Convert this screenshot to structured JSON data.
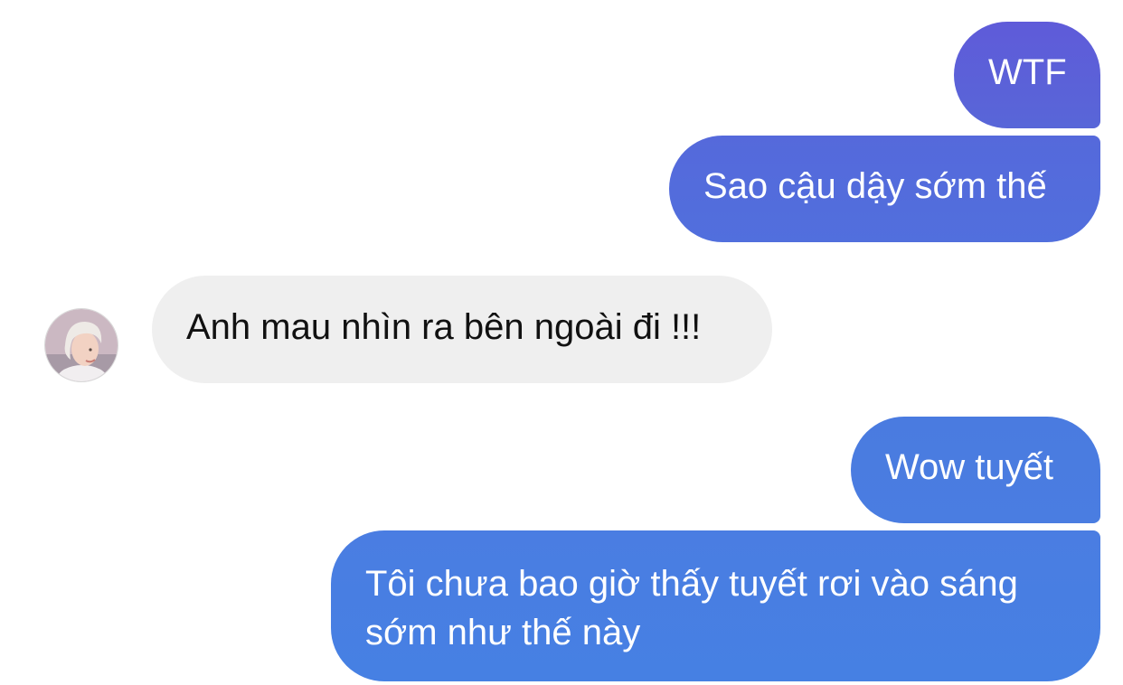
{
  "messages": [
    {
      "sender": "me",
      "text": "WTF"
    },
    {
      "sender": "me",
      "text": "Sao cậu dậy sớm thế"
    },
    {
      "sender": "other",
      "text": "Anh mau nhìn ra bên ngoài đi !!!"
    },
    {
      "sender": "me",
      "text": "Wow tuyết"
    },
    {
      "sender": "me",
      "text": "Tôi chưa bao giờ thấy tuyết rơi vào sáng sớm như thế này"
    }
  ],
  "colors": {
    "sent_bubble_top": "#5f5bd9",
    "sent_bubble_bottom": "#4680e3",
    "received_bubble": "#efefef",
    "received_text": "#111111",
    "sent_text": "#ffffff"
  },
  "avatar": {
    "icon": "user-avatar-photo"
  }
}
